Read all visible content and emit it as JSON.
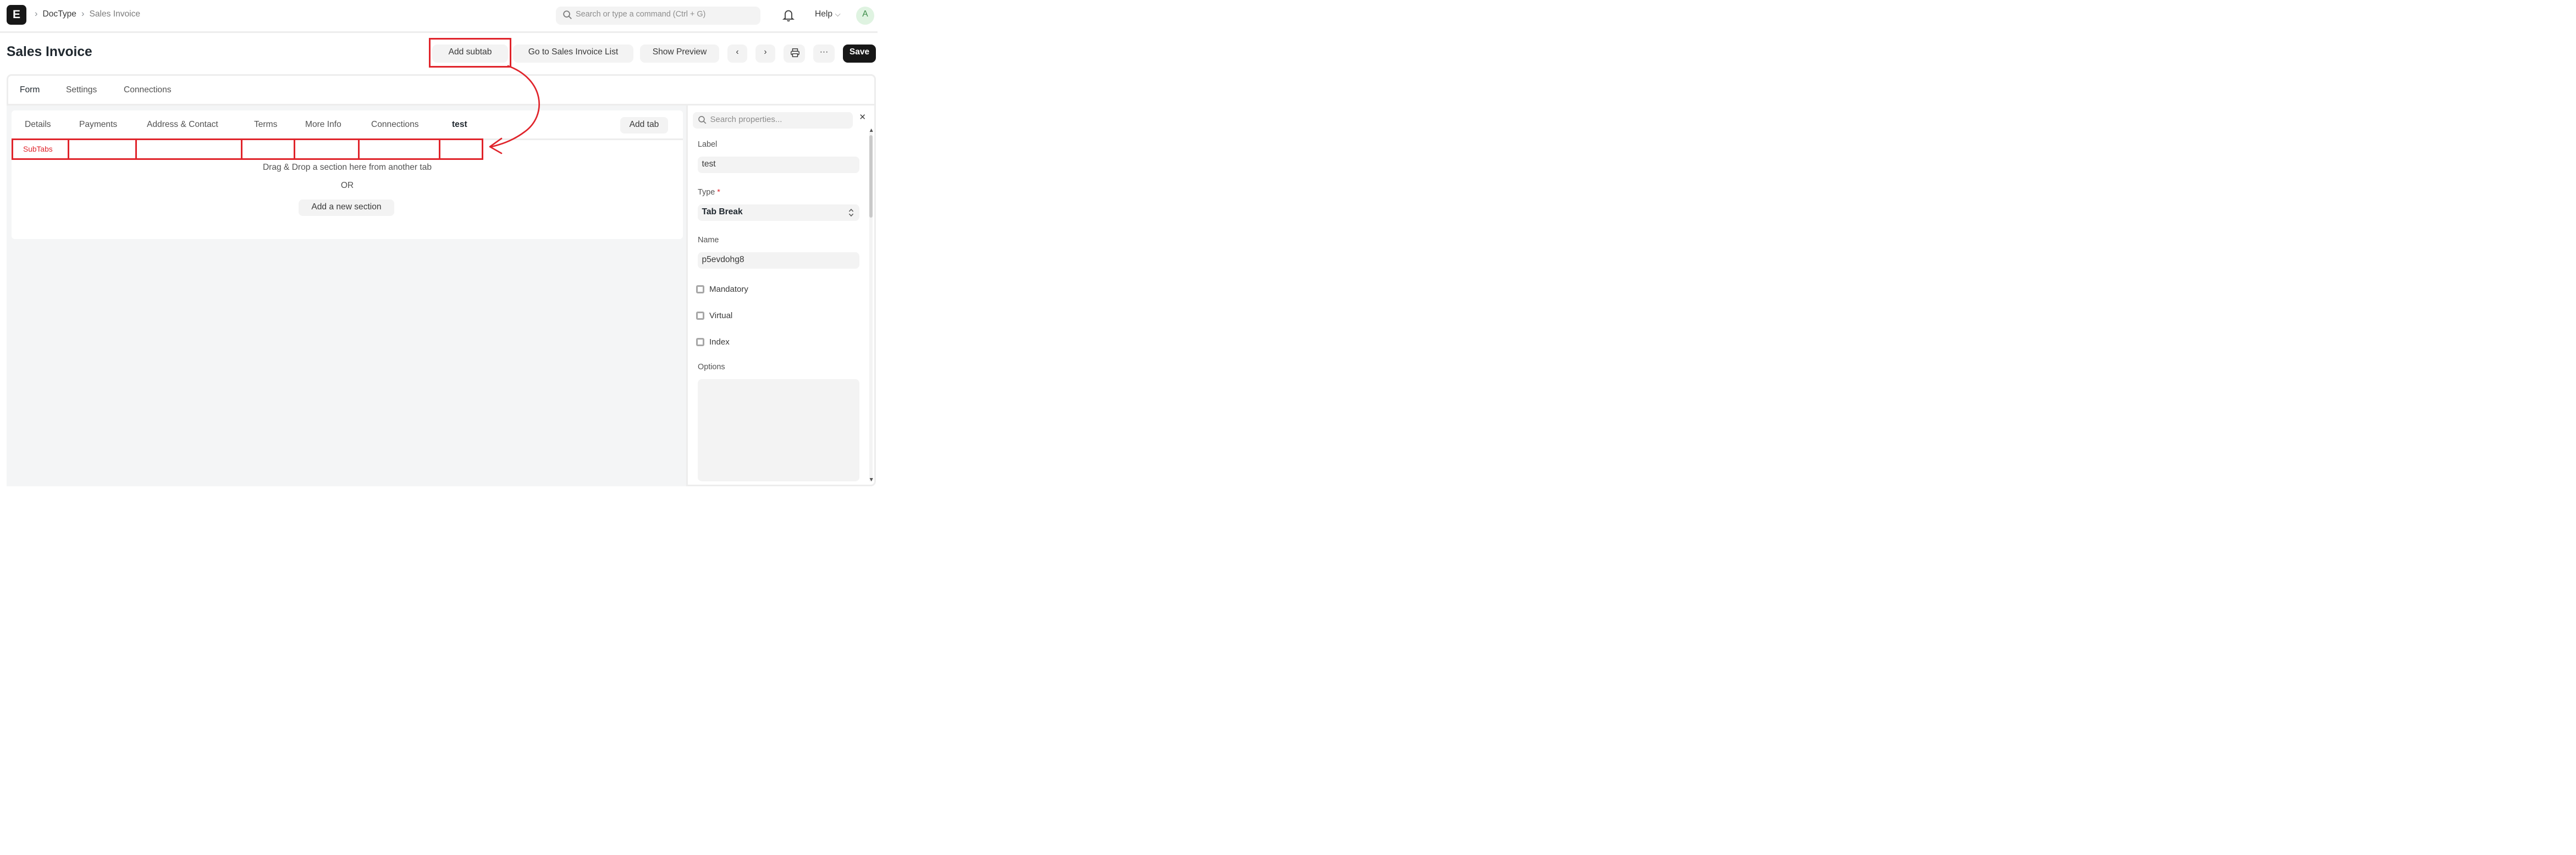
{
  "navbar": {
    "logo_letter": "E",
    "breadcrumbs": [
      "DocType",
      "Sales Invoice"
    ],
    "search_placeholder": "Search or type a command (Ctrl + G)",
    "help_label": "Help",
    "avatar_initial": "A"
  },
  "header": {
    "title": "Sales Invoice",
    "add_subtab_label": "Add subtab",
    "goto_list_label": "Go to Sales Invoice List",
    "show_preview_label": "Show Preview",
    "more_label": "···",
    "save_label": "Save"
  },
  "top_tabs": [
    "Form",
    "Settings",
    "Connections"
  ],
  "form_tabs": [
    "Details",
    "Payments",
    "Address & Contact",
    "Terms",
    "More Info",
    "Connections",
    "test"
  ],
  "add_tab_label": "Add tab",
  "subtabs_label": "SubTabs",
  "drop_hint": "Drag & Drop a section here from another tab",
  "or_text": "OR",
  "add_section_label": "Add a new section",
  "properties": {
    "search_placeholder": "Search properties...",
    "close_glyph": "×",
    "label_title": "Label",
    "label_value": "test",
    "type_title": "Type",
    "type_required_mark": "*",
    "type_value": "Tab Break",
    "name_title": "Name",
    "name_value": "p5evdohg8",
    "checkboxes": [
      "Mandatory",
      "Virtual",
      "Index"
    ],
    "options_title": "Options",
    "options_value": ""
  },
  "colors": {
    "annotation_red": "#e0242b",
    "save_bg": "#171717"
  },
  "icons": [
    "search-icon",
    "bell-icon",
    "chevron-left-icon",
    "chevron-right-icon",
    "printer-icon",
    "close-icon",
    "select-arrows-icon"
  ]
}
